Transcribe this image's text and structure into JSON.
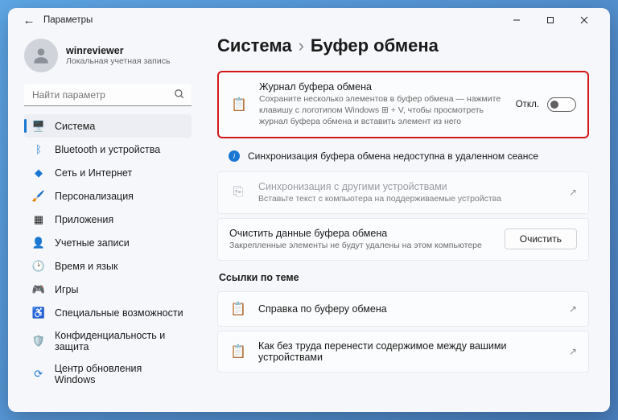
{
  "titlebar": {
    "title": "Параметры"
  },
  "user": {
    "name": "winreviewer",
    "sub": "Локальная учетная запись"
  },
  "search": {
    "placeholder": "Найти параметр"
  },
  "nav": [
    {
      "label": "Система",
      "active": true
    },
    {
      "label": "Bluetooth и устройства"
    },
    {
      "label": "Сеть и Интернет"
    },
    {
      "label": "Персонализация"
    },
    {
      "label": "Приложения"
    },
    {
      "label": "Учетные записи"
    },
    {
      "label": "Время и язык"
    },
    {
      "label": "Игры"
    },
    {
      "label": "Специальные возможности"
    },
    {
      "label": "Конфиденциальность и защита"
    },
    {
      "label": "Центр обновления Windows"
    }
  ],
  "crumbs": {
    "a": "Система",
    "sep": "›",
    "b": "Буфер обмена"
  },
  "cards": {
    "history": {
      "title": "Журнал буфера обмена",
      "sub": "Сохраните несколько элементов в буфер обмена — нажмите клавишу с логотипом Windows ⊞ + V, чтобы просмотреть журнал буфера обмена и вставить элемент из него",
      "toggle": "Откл."
    },
    "info": {
      "text": "Синхронизация буфера обмена недоступна в удаленном сеансе"
    },
    "sync": {
      "title": "Синхронизация с другими устройствами",
      "sub": "Вставьте текст с компьютера на поддерживаемые устройства"
    },
    "clear": {
      "title": "Очистить данные буфера обмена",
      "sub": "Закрепленные элементы не будут удалены на этом компьютере",
      "btn": "Очистить"
    }
  },
  "links": {
    "heading": "Ссылки по теме",
    "a": "Справка по буферу обмена",
    "b": "Как без труда перенести содержимое между вашими устройствами"
  }
}
